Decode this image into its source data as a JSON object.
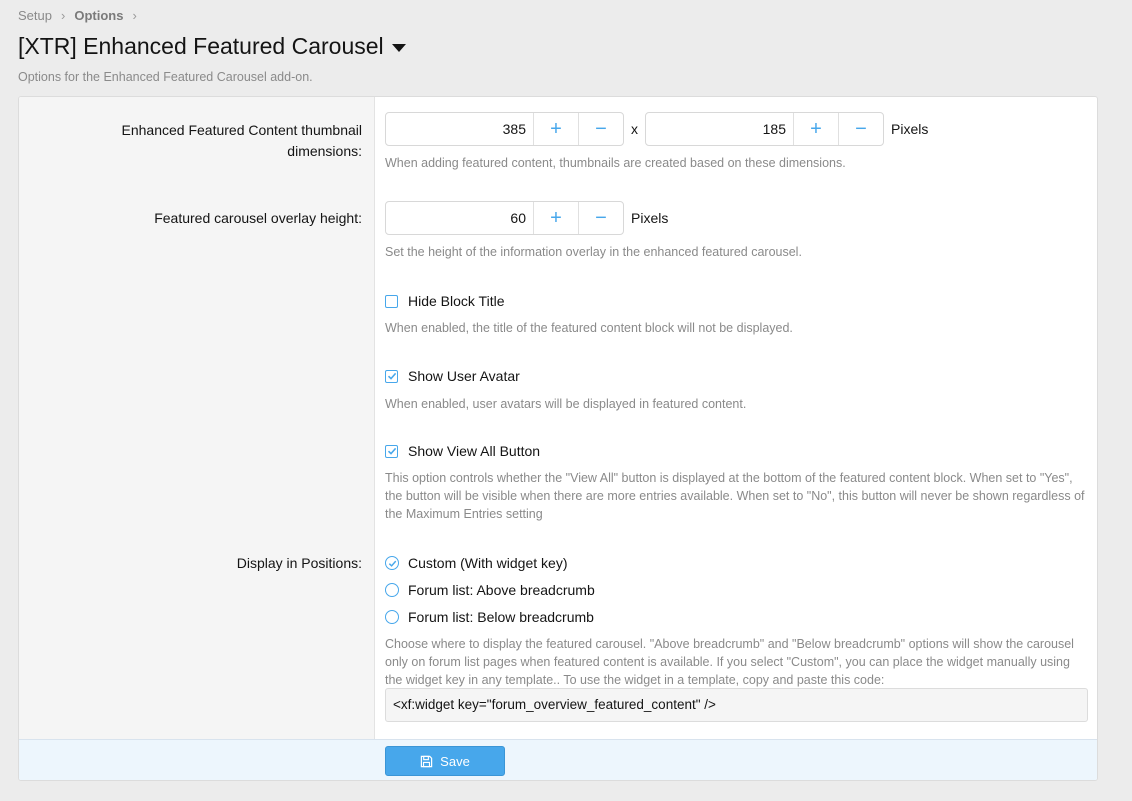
{
  "breadcrumb": {
    "items": [
      "Setup",
      "Options"
    ],
    "separator": "›"
  },
  "page": {
    "title": "[XTR] Enhanced Featured Carousel",
    "description": "Options for the Enhanced Featured Carousel add-on."
  },
  "thumbnail": {
    "label": "Enhanced Featured Content thumbnail dimensions:",
    "width_value": "385",
    "height_value": "185",
    "times": "x",
    "unit": "Pixels",
    "plus": "+",
    "minus": "−",
    "hint": "When adding featured content, thumbnails are created based on these dimensions."
  },
  "overlay": {
    "label": "Featured carousel overlay height:",
    "value": "60",
    "unit": "Pixels",
    "plus": "+",
    "minus": "−",
    "hint": "Set the height of the information overlay in the enhanced featured carousel."
  },
  "hide_title": {
    "label": "Hide Block Title",
    "checked": false,
    "hint": "When enabled, the title of the featured content block will not be displayed."
  },
  "show_avatar": {
    "label": "Show User Avatar",
    "checked": true,
    "hint": "When enabled, user avatars will be displayed in featured content."
  },
  "show_view_all": {
    "label": "Show View All Button",
    "checked": true,
    "hint": "This option controls whether the \"View All\" button is displayed at the bottom of the featured content block. When set to \"Yes\", the button will be visible when there are more entries available. When set to \"No\", this button will never be shown regardless of the Maximum Entries setting"
  },
  "positions": {
    "label": "Display in Positions:",
    "options": [
      {
        "label": "Custom (With widget key)",
        "checked": true
      },
      {
        "label": "Forum list: Above breadcrumb",
        "checked": false
      },
      {
        "label": "Forum list: Below breadcrumb",
        "checked": false
      }
    ],
    "hint": "Choose where to display the featured carousel. \"Above breadcrumb\" and \"Below breadcrumb\" options will show the carousel only on forum list pages when featured content is available. If you select \"Custom\", you can place the widget manually using the widget key in any template.. To use the widget in a template, copy and paste this code:",
    "code": "<xf:widget key=\"forum_overview_featured_content\" />"
  },
  "footer": {
    "save_label": "Save"
  },
  "colors": {
    "accent": "#47a7eb",
    "footer_bg": "#edf6fd",
    "label_bg": "#f5f5f5",
    "page_bg": "#ececec"
  },
  "icons": {
    "title_menu": "caret-down-icon",
    "save": "save-icon",
    "check": "check-icon"
  }
}
